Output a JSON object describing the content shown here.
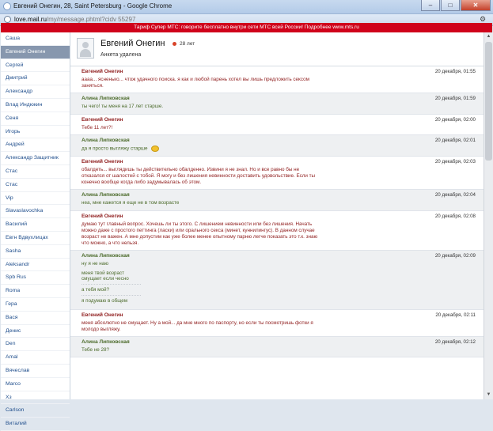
{
  "browser": {
    "tab_title": "Евгений Онегин, 28, Saint Petersburg - Google Chrome",
    "url_host": "love.mail.ru",
    "url_path": "/my/message.phtml?cidv 55297",
    "window_buttons": [
      "–",
      "□",
      "✕"
    ]
  },
  "banner": {
    "text": "Тариф Супер МТС: говорите бесплатно внутри сети МТС всей России! Подробнее www.mts.ru"
  },
  "sidebar": {
    "items": [
      {
        "label": "Саша"
      },
      {
        "label": "Евгений Онегин",
        "active": true
      },
      {
        "label": "Сергей"
      },
      {
        "label": "Дмитрий"
      },
      {
        "label": "Александр"
      },
      {
        "label": "Влад Индюкин"
      },
      {
        "label": "Сеня"
      },
      {
        "label": "Игорь"
      },
      {
        "label": "Андрей"
      },
      {
        "label": "Александр Защитник"
      },
      {
        "label": "Стас"
      },
      {
        "label": "Стас"
      },
      {
        "label": "Vip"
      },
      {
        "label": "Slavaslavochka"
      },
      {
        "label": "Василий"
      },
      {
        "label": "Евгн Вдвухлицах"
      },
      {
        "label": "Sasha"
      },
      {
        "label": "Aleksandr"
      },
      {
        "label": "Spb Rus"
      },
      {
        "label": "Roma"
      },
      {
        "label": "Гера"
      },
      {
        "label": "Вася"
      },
      {
        "label": "Денис"
      },
      {
        "label": "Den"
      },
      {
        "label": "Amal"
      },
      {
        "label": "Вячеслав"
      },
      {
        "label": "Marco"
      },
      {
        "label": "Хз"
      },
      {
        "label": "Carlson"
      },
      {
        "label": "Виталий"
      }
    ]
  },
  "profile": {
    "name": "Евгений Онегин",
    "age": "28 лет",
    "status": "Анкета удалена"
  },
  "messages": [
    {
      "author": "Евгений Онегин",
      "who": "red",
      "time": "20 декабря, 01:55",
      "text": "аааа... ясненько... чтож удачного поиска. я как и любой парень хотел вы лишь предложить сексом заняться."
    },
    {
      "author": "Алина Липковская",
      "who": "green",
      "time": "20 декабря, 01:59",
      "text": "ты чего! ты меня на 17 лет старше."
    },
    {
      "author": "Евгений Онегин",
      "who": "red",
      "time": "20 декабря, 02:00",
      "text": "Тебе 11 лет?!"
    },
    {
      "author": "Алина Липковская",
      "who": "green",
      "time": "20 декабря, 02:01",
      "text": "да я просто выгляжу старше",
      "smile": true
    },
    {
      "author": "Евгений Онегин",
      "who": "red",
      "time": "20 декабря, 02:03",
      "text": "обалдеть... выглядишь ты действительно обалденно. Извини я не знал. Но и все равно бы не отказался от шалостей с тобой. Я могу и без лишения невинности доставить удовольствие. Если ты конечно вообще когда либо задумывалась об этом."
    },
    {
      "author": "Алина Липковская",
      "who": "green",
      "time": "20 декабря, 02:04",
      "text": "неа, мне кажется я еще не в том возрасте"
    },
    {
      "author": "Евгений Онегин",
      "who": "red",
      "time": "20 декабря, 02:08",
      "text": "думаю тут главный вопрос. Хочешь ли ты этого. С лишением невинности или без лишения. Начать можно даже с простого петтинга (ласки) или орального секса (минет, куннилингус). В данном случае возраст не важен. А мне допустим как уже более менее опытному парню легче показать это т.к. знаю что можно, а что нельзя."
    },
    {
      "author": "Алина Липковская",
      "who": "green",
      "time": "20 декабря, 02:09",
      "text": "ну я не наю",
      "extra": [
        "меня твой возраст смущает если чесно",
        "а тебя мой?",
        "я подумаю в общем"
      ]
    },
    {
      "author": "Евгений Онегин",
      "who": "red",
      "time": "20 декабря, 02:11",
      "text": "меня абсолютно не смущает. Ну а мой... да мне много по паспорту, но если ты посмотришь фотки я молодо выгляжу."
    },
    {
      "author": "Алина Липковская",
      "who": "green",
      "time": "20 декабря, 02:12",
      "text": "Тебе не 28?"
    }
  ],
  "colors": {
    "banner": "#d0021b",
    "author_red": "#8f1d1d",
    "author_green": "#4b6a2a",
    "sidebar_active": "#8797ae",
    "link": "#1f4e8c"
  },
  "icons": [
    "browser-favicon-icon",
    "page-icon",
    "wrench-icon",
    "male-gender-icon",
    "smile-emoticon-icon"
  ]
}
